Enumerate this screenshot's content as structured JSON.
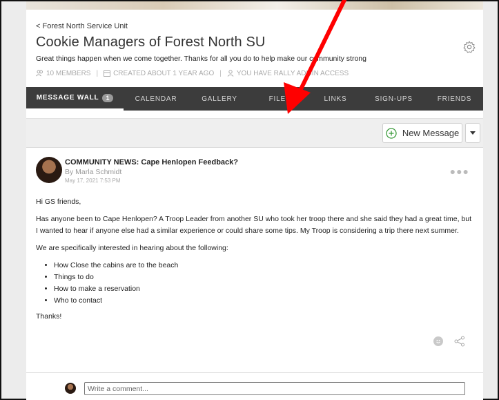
{
  "header": {
    "back_link": "< Forest North Service Unit",
    "title": "Cookie Managers of Forest North SU",
    "tagline": "Great things happen when we come together. Thanks for all you do to help make our community strong",
    "meta": {
      "members": "10 MEMBERS",
      "created": "CREATED ABOUT 1 YEAR AGO",
      "access": "YOU HAVE RALLY ADMIN ACCESS"
    },
    "settings_icon": "gear-icon"
  },
  "tabs": [
    {
      "label": "MESSAGE WALL",
      "badge": "1",
      "active": true
    },
    {
      "label": "CALENDAR"
    },
    {
      "label": "GALLERY"
    },
    {
      "label": "FILES"
    },
    {
      "label": "LINKS"
    },
    {
      "label": "SIGN-UPS"
    },
    {
      "label": "FRIENDS"
    }
  ],
  "toolbar": {
    "new_message_label": "New Message",
    "new_message_icon": "plus-circle-icon",
    "dropdown_icon": "caret-down-icon"
  },
  "post": {
    "title": "COMMUNITY NEWS: Cape Henlopen Feedback?",
    "author": "By Marla Schmidt",
    "date": "May 17, 2021 7:53 PM",
    "more_icon": "ellipsis-icon",
    "greeting": "Hi GS friends,",
    "paragraph1": "Has anyone been to Cape Henlopen? A Troop Leader from another SU who took her troop there and she said they had a great time, but I wanted to hear if anyone else had a similar experience or could share some tips. My Troop is considering a trip there next summer.",
    "paragraph2": "We are specifically interested in hearing about the following:",
    "bullets": [
      "How Close the cabins are to the beach",
      "Things to do",
      "How to make a reservation",
      "Who to contact"
    ],
    "closing": "Thanks!",
    "reaction_icon": "smiley-icon",
    "share_icon": "share-icon"
  },
  "comment": {
    "placeholder": "Write a comment..."
  },
  "annotation": {
    "color": "#ff0000"
  }
}
